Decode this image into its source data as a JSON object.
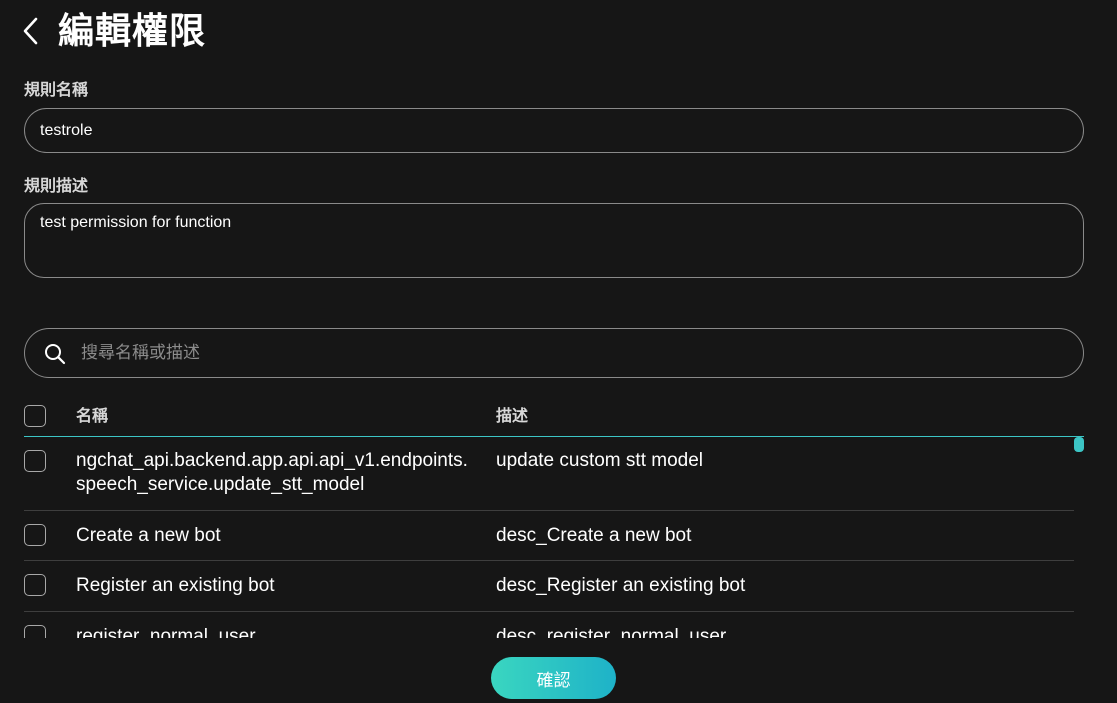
{
  "header": {
    "back_icon": "chevron-left-icon",
    "title": "編輯權限"
  },
  "form": {
    "name_label": "規則名稱",
    "name_value": "testrole",
    "desc_label": "規則描述",
    "desc_value": "test permission for function"
  },
  "search": {
    "icon": "search-icon",
    "placeholder": "搜尋名稱或描述"
  },
  "table": {
    "columns": [
      "名稱",
      "描述"
    ],
    "rows": [
      {
        "name": "ngchat_api.backend.app.api.api_v1.endpoints.speech_service.update_stt_model",
        "description": "update custom stt model",
        "checked": false
      },
      {
        "name": "Create a new bot",
        "description": "desc_Create a new bot",
        "checked": false
      },
      {
        "name": "Register an existing bot",
        "description": "desc_Register an existing bot",
        "checked": false
      },
      {
        "name": "register_normal_user",
        "description": "desc_register_normal_user",
        "checked": false
      }
    ]
  },
  "footer": {
    "confirm_label": "確認"
  },
  "colors": {
    "background": "#161616",
    "accent": "#3cc5c5",
    "button_gradient_start": "#3ad6c0",
    "button_gradient_end": "#1eb2c8"
  }
}
